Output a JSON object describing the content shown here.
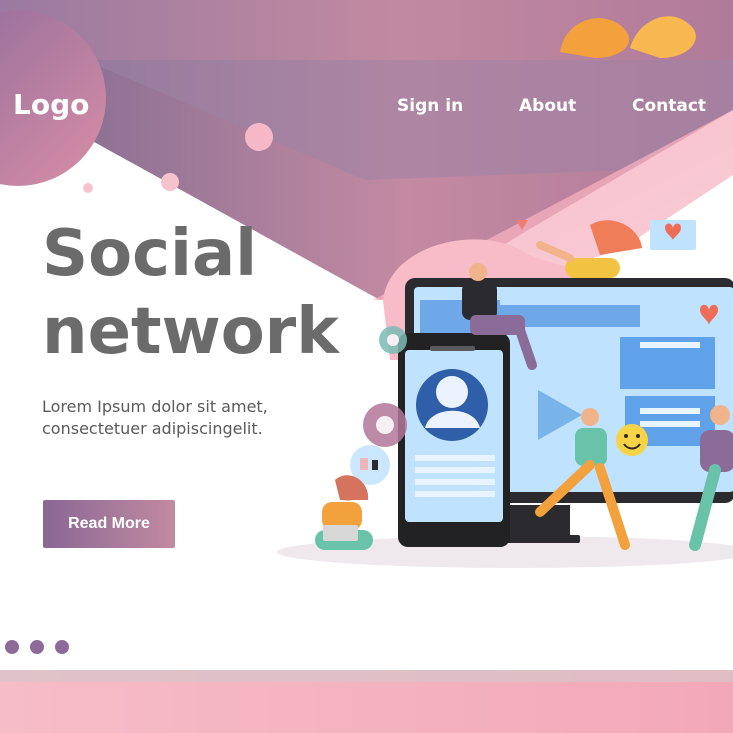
{
  "brand": {
    "logo": "Logo",
    "accent": "#8d6a98",
    "accent_2": "#c28aa0"
  },
  "nav": {
    "sign_in": "Sign in",
    "about": "About",
    "contact": "Contact"
  },
  "hero": {
    "title_line_1": "Social",
    "title_line_2": "network",
    "description": "Lorem Ipsum dolor sit amet, consectetuer adipiscingelit.",
    "button": "Read More"
  },
  "pagination": {
    "dots": 3
  }
}
